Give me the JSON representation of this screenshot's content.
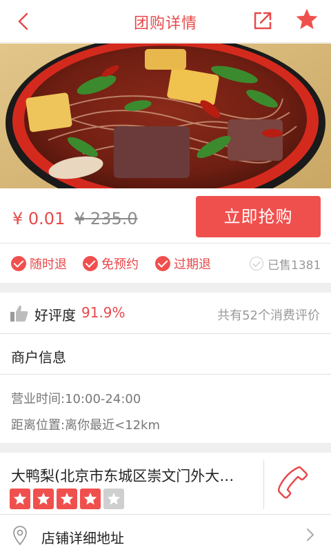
{
  "nav": {
    "title": "团购详情",
    "back_icon": "chevron-left-icon",
    "share_icon": "share-icon",
    "favorite_icon": "star-icon"
  },
  "hero": {
    "image": "spicy-noodle-soup-photo"
  },
  "price": {
    "current": "¥ 0.01",
    "original": "¥ 235.0",
    "buy_label": "立即抢购"
  },
  "tags": {
    "items": [
      "随时退",
      "免预约",
      "过期退"
    ],
    "sold": "已售1381"
  },
  "rating": {
    "label": "好评度",
    "percent": "91.9%",
    "count_text": "共有52个消费评价"
  },
  "merchant": {
    "header": "商户信息",
    "hours": "营业时间:10:00-24:00",
    "distance": "距离位置:离你最近<12km"
  },
  "store": {
    "name": "大鸭梨(北京市东城区崇文门外大…",
    "stars_filled": 4,
    "stars_total": 5
  },
  "address": {
    "label": "店铺详细地址"
  },
  "colors": {
    "accent": "#e8484a",
    "button": "#f0504d",
    "star_on": "#f0504d",
    "star_off": "#cfcfcf"
  }
}
